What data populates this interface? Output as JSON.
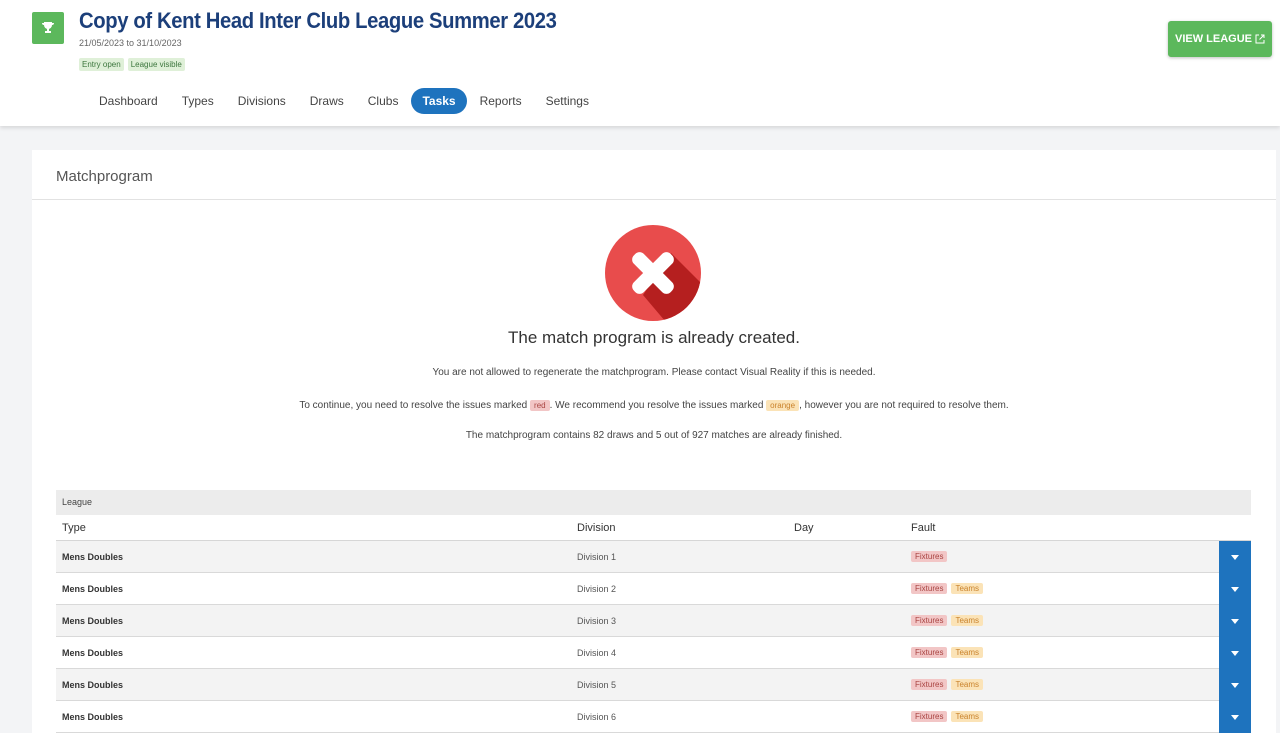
{
  "header": {
    "title": "Copy of Kent Head Inter Club League Summer 2023",
    "dates": "21/05/2023 to 31/10/2023",
    "badges": [
      "Entry open",
      "League visible"
    ],
    "view_league_label": "VIEW LEAGUE",
    "icon": "trophy-icon"
  },
  "nav": {
    "items": [
      "Dashboard",
      "Types",
      "Divisions",
      "Draws",
      "Clubs",
      "Tasks",
      "Reports",
      "Settings"
    ],
    "active": "Tasks"
  },
  "panel": {
    "title": "Matchprogram",
    "status_icon": "error-x-icon",
    "message_title": "The match program is already created.",
    "line1": "You are not allowed to regenerate the matchprogram. Please contact Visual Reality if this is needed.",
    "line2_a": "To continue, you need to resolve the issues marked",
    "line2_red": "red",
    "line2_b": ". We recommend you resolve the issues marked",
    "line2_orange": "orange",
    "line2_c": ", however you are not required to resolve them.",
    "line3": "The matchprogram contains 82 draws and 5 out of 927 matches are already finished."
  },
  "table": {
    "group": "League",
    "headers": {
      "type": "Type",
      "division": "Division",
      "day": "Day",
      "fault": "Fault"
    },
    "rows": [
      {
        "type": "Mens Doubles",
        "division": "Division 1",
        "day": "",
        "faults_red": [
          "Fixtures"
        ],
        "faults_orange": []
      },
      {
        "type": "Mens Doubles",
        "division": "Division 2",
        "day": "",
        "faults_red": [
          "Fixtures"
        ],
        "faults_orange": [
          "Teams"
        ]
      },
      {
        "type": "Mens Doubles",
        "division": "Division 3",
        "day": "",
        "faults_red": [
          "Fixtures"
        ],
        "faults_orange": [
          "Teams"
        ]
      },
      {
        "type": "Mens Doubles",
        "division": "Division 4",
        "day": "",
        "faults_red": [
          "Fixtures"
        ],
        "faults_orange": [
          "Teams"
        ]
      },
      {
        "type": "Mens Doubles",
        "division": "Division 5",
        "day": "",
        "faults_red": [
          "Fixtures"
        ],
        "faults_orange": [
          "Teams"
        ]
      },
      {
        "type": "Mens Doubles",
        "division": "Division 6",
        "day": "",
        "faults_red": [
          "Fixtures"
        ],
        "faults_orange": [
          "Teams"
        ]
      }
    ]
  },
  "colors": {
    "brand_blue": "#1e73be",
    "title_blue": "#1c3f7a",
    "green": "#5cb85c",
    "error_red": "#e84c4c"
  }
}
